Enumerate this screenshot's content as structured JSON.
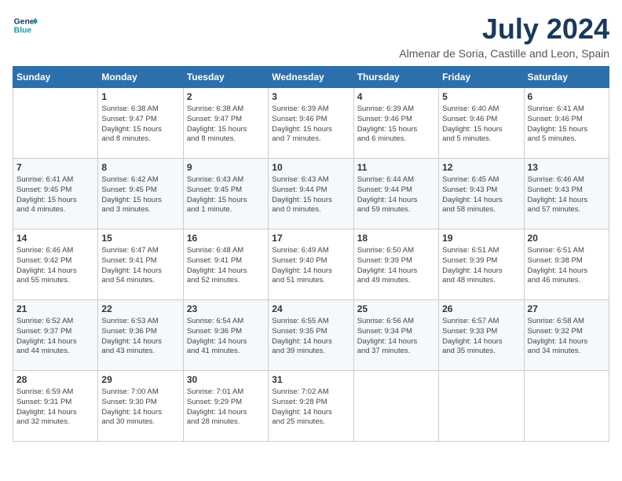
{
  "header": {
    "logo_line1": "General",
    "logo_line2": "Blue",
    "month": "July 2024",
    "location": "Almenar de Soria, Castille and Leon, Spain"
  },
  "weekdays": [
    "Sunday",
    "Monday",
    "Tuesday",
    "Wednesday",
    "Thursday",
    "Friday",
    "Saturday"
  ],
  "weeks": [
    [
      {
        "day": "",
        "content": ""
      },
      {
        "day": "1",
        "content": "Sunrise: 6:38 AM\nSunset: 9:47 PM\nDaylight: 15 hours\nand 8 minutes."
      },
      {
        "day": "2",
        "content": "Sunrise: 6:38 AM\nSunset: 9:47 PM\nDaylight: 15 hours\nand 8 minutes."
      },
      {
        "day": "3",
        "content": "Sunrise: 6:39 AM\nSunset: 9:46 PM\nDaylight: 15 hours\nand 7 minutes."
      },
      {
        "day": "4",
        "content": "Sunrise: 6:39 AM\nSunset: 9:46 PM\nDaylight: 15 hours\nand 6 minutes."
      },
      {
        "day": "5",
        "content": "Sunrise: 6:40 AM\nSunset: 9:46 PM\nDaylight: 15 hours\nand 5 minutes."
      },
      {
        "day": "6",
        "content": "Sunrise: 6:41 AM\nSunset: 9:46 PM\nDaylight: 15 hours\nand 5 minutes."
      }
    ],
    [
      {
        "day": "7",
        "content": "Sunrise: 6:41 AM\nSunset: 9:45 PM\nDaylight: 15 hours\nand 4 minutes."
      },
      {
        "day": "8",
        "content": "Sunrise: 6:42 AM\nSunset: 9:45 PM\nDaylight: 15 hours\nand 3 minutes."
      },
      {
        "day": "9",
        "content": "Sunrise: 6:43 AM\nSunset: 9:45 PM\nDaylight: 15 hours\nand 1 minute."
      },
      {
        "day": "10",
        "content": "Sunrise: 6:43 AM\nSunset: 9:44 PM\nDaylight: 15 hours\nand 0 minutes."
      },
      {
        "day": "11",
        "content": "Sunrise: 6:44 AM\nSunset: 9:44 PM\nDaylight: 14 hours\nand 59 minutes."
      },
      {
        "day": "12",
        "content": "Sunrise: 6:45 AM\nSunset: 9:43 PM\nDaylight: 14 hours\nand 58 minutes."
      },
      {
        "day": "13",
        "content": "Sunrise: 6:46 AM\nSunset: 9:43 PM\nDaylight: 14 hours\nand 57 minutes."
      }
    ],
    [
      {
        "day": "14",
        "content": "Sunrise: 6:46 AM\nSunset: 9:42 PM\nDaylight: 14 hours\nand 55 minutes."
      },
      {
        "day": "15",
        "content": "Sunrise: 6:47 AM\nSunset: 9:41 PM\nDaylight: 14 hours\nand 54 minutes."
      },
      {
        "day": "16",
        "content": "Sunrise: 6:48 AM\nSunset: 9:41 PM\nDaylight: 14 hours\nand 52 minutes."
      },
      {
        "day": "17",
        "content": "Sunrise: 6:49 AM\nSunset: 9:40 PM\nDaylight: 14 hours\nand 51 minutes."
      },
      {
        "day": "18",
        "content": "Sunrise: 6:50 AM\nSunset: 9:39 PM\nDaylight: 14 hours\nand 49 minutes."
      },
      {
        "day": "19",
        "content": "Sunrise: 6:51 AM\nSunset: 9:39 PM\nDaylight: 14 hours\nand 48 minutes."
      },
      {
        "day": "20",
        "content": "Sunrise: 6:51 AM\nSunset: 9:38 PM\nDaylight: 14 hours\nand 46 minutes."
      }
    ],
    [
      {
        "day": "21",
        "content": "Sunrise: 6:52 AM\nSunset: 9:37 PM\nDaylight: 14 hours\nand 44 minutes."
      },
      {
        "day": "22",
        "content": "Sunrise: 6:53 AM\nSunset: 9:36 PM\nDaylight: 14 hours\nand 43 minutes."
      },
      {
        "day": "23",
        "content": "Sunrise: 6:54 AM\nSunset: 9:36 PM\nDaylight: 14 hours\nand 41 minutes."
      },
      {
        "day": "24",
        "content": "Sunrise: 6:55 AM\nSunset: 9:35 PM\nDaylight: 14 hours\nand 39 minutes."
      },
      {
        "day": "25",
        "content": "Sunrise: 6:56 AM\nSunset: 9:34 PM\nDaylight: 14 hours\nand 37 minutes."
      },
      {
        "day": "26",
        "content": "Sunrise: 6:57 AM\nSunset: 9:33 PM\nDaylight: 14 hours\nand 35 minutes."
      },
      {
        "day": "27",
        "content": "Sunrise: 6:58 AM\nSunset: 9:32 PM\nDaylight: 14 hours\nand 34 minutes."
      }
    ],
    [
      {
        "day": "28",
        "content": "Sunrise: 6:59 AM\nSunset: 9:31 PM\nDaylight: 14 hours\nand 32 minutes."
      },
      {
        "day": "29",
        "content": "Sunrise: 7:00 AM\nSunset: 9:30 PM\nDaylight: 14 hours\nand 30 minutes."
      },
      {
        "day": "30",
        "content": "Sunrise: 7:01 AM\nSunset: 9:29 PM\nDaylight: 14 hours\nand 28 minutes."
      },
      {
        "day": "31",
        "content": "Sunrise: 7:02 AM\nSunset: 9:28 PM\nDaylight: 14 hours\nand 25 minutes."
      },
      {
        "day": "",
        "content": ""
      },
      {
        "day": "",
        "content": ""
      },
      {
        "day": "",
        "content": ""
      }
    ]
  ]
}
